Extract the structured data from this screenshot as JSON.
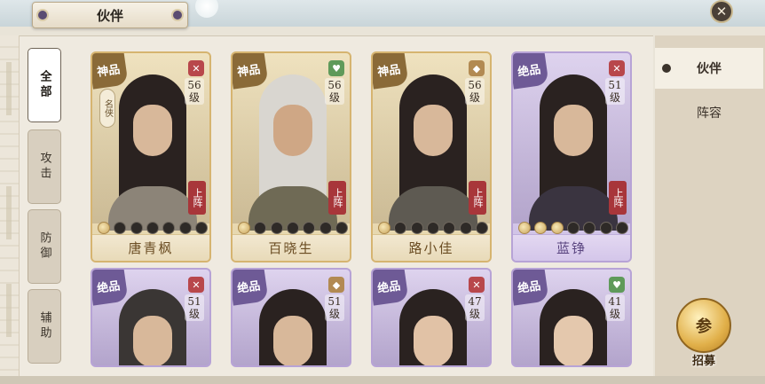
{
  "header": {
    "title": "伙伴",
    "close_icon": "close-icon"
  },
  "categories": [
    {
      "label": "全部",
      "active": true
    },
    {
      "label": "攻击",
      "active": false
    },
    {
      "label": "防御",
      "active": false
    },
    {
      "label": "辅助",
      "active": false
    }
  ],
  "partners": [
    {
      "name": "唐青枫",
      "grade": "神品",
      "level": "56",
      "level_unit": "级",
      "role_icon": "sword-icon",
      "badge": "名侠",
      "deploy": "上阵",
      "stars_on": 1,
      "stars_total": 7,
      "theme": "gold"
    },
    {
      "name": "百晓生",
      "grade": "神品",
      "level": "56",
      "level_unit": "级",
      "role_icon": "heal-icon",
      "deploy": "上阵",
      "stars_on": 1,
      "stars_total": 7,
      "theme": "gold"
    },
    {
      "name": "路小佳",
      "grade": "神品",
      "level": "56",
      "level_unit": "级",
      "role_icon": "shield-icon",
      "deploy": "上阵",
      "stars_on": 1,
      "stars_total": 7,
      "theme": "gold"
    },
    {
      "name": "蓝铮",
      "grade": "绝品",
      "level": "51",
      "level_unit": "级",
      "role_icon": "sword-icon",
      "deploy": "上阵",
      "stars_on": 3,
      "stars_total": 7,
      "theme": "purple"
    },
    {
      "grade": "绝品",
      "level": "51",
      "level_unit": "级",
      "role_icon": "sword-icon",
      "theme": "purple"
    },
    {
      "grade": "绝品",
      "level": "51",
      "level_unit": "级",
      "role_icon": "shield-icon",
      "theme": "purple"
    },
    {
      "grade": "绝品",
      "level": "47",
      "level_unit": "级",
      "role_icon": "sword-icon",
      "theme": "purple"
    },
    {
      "grade": "绝品",
      "level": "41",
      "level_unit": "级",
      "role_icon": "heal-icon",
      "theme": "purple"
    }
  ],
  "side_menu": [
    {
      "label": "伙伴",
      "active": true
    },
    {
      "label": "阵容",
      "active": false
    }
  ],
  "recruit": {
    "label": "招募",
    "icon_char": "参"
  }
}
